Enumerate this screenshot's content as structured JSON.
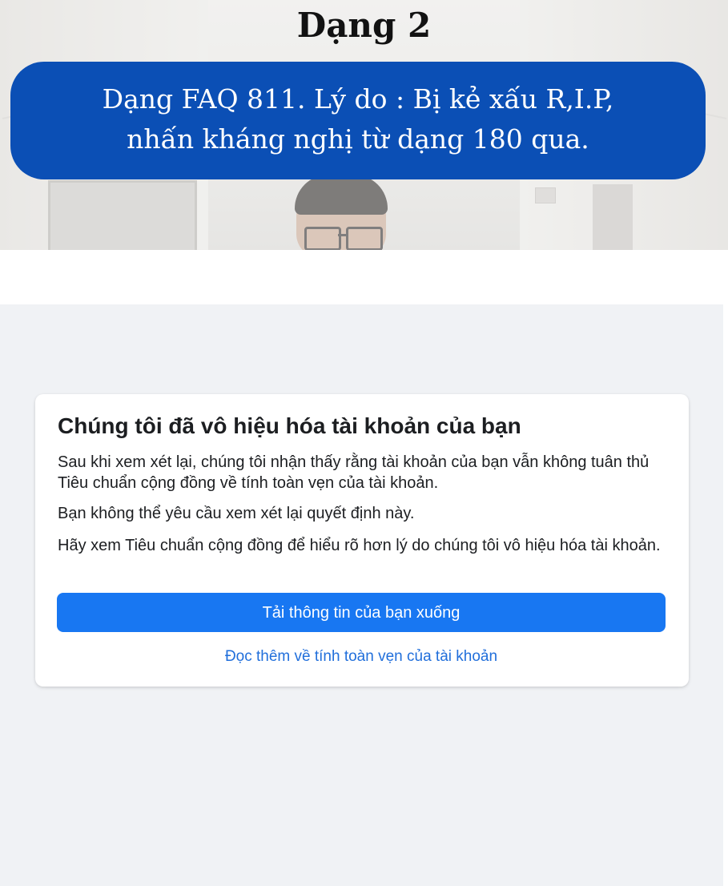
{
  "heading": "Dạng 2",
  "banner": {
    "line1": "Dạng FAQ 811. Lý do : Bị kẻ xấu R,I.P,",
    "line2": "nhấn kháng nghị từ dạng 180 qua."
  },
  "card": {
    "title": "Chúng tôi đã vô hiệu hóa tài khoản của bạn",
    "paragraph1": "Sau khi xem xét lại, chúng tôi nhận thấy rằng tài khoản của bạn vẫn không tuân thủ Tiêu chuẩn cộng đồng về tính toàn vẹn của tài khoản.",
    "paragraph2": "Bạn không thể yêu cầu xem xét lại quyết định này.",
    "paragraph3": "Hãy xem Tiêu chuẩn cộng đồng để hiểu rõ hơn lý do chúng tôi vô hiệu hóa tài khoản.",
    "download_button": "Tải thông tin của bạn xuống",
    "learn_more_link": "Đọc thêm về tính toàn vẹn của tài khoản"
  },
  "colors": {
    "banner_bg": "#0b4fb5",
    "primary_button": "#1877f2",
    "link": "#216fdb",
    "page_bg": "#f0f2f5"
  }
}
